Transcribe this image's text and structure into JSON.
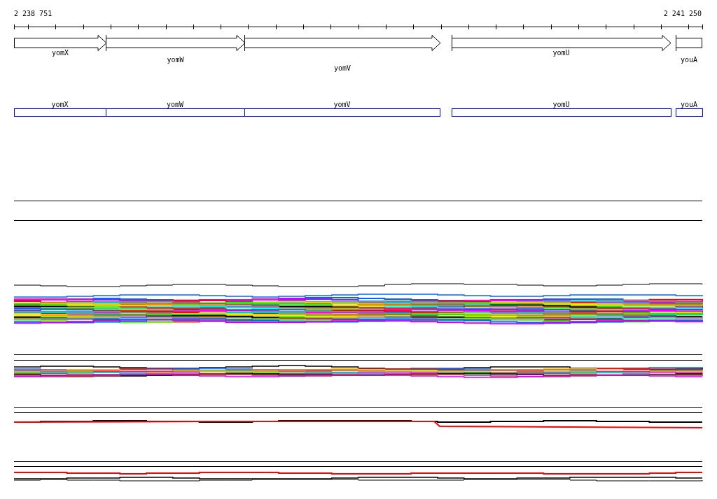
{
  "ruler": {
    "start_label": "2 238 751",
    "end_label": "2 241 250"
  },
  "gene_track": [
    {
      "name": "yomX",
      "kind": "arrow"
    },
    {
      "name": "yomW",
      "kind": "arrow"
    },
    {
      "name": "yomV",
      "kind": "arrow"
    },
    {
      "name": "yomU",
      "kind": "arrow"
    },
    {
      "name": "youA",
      "kind": "clipped"
    }
  ],
  "annotation_track": [
    {
      "name": "yomX"
    },
    {
      "name": "yomW"
    },
    {
      "name": "yomV"
    },
    {
      "name": "yomU"
    },
    {
      "name": "youA"
    }
  ]
}
